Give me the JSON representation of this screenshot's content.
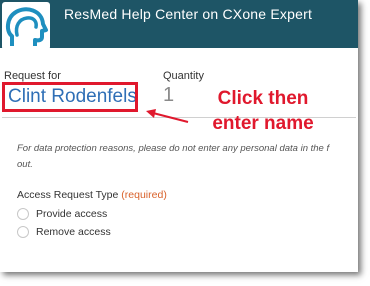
{
  "header": {
    "title": "ResMed Help Center on CXone Expert",
    "logo_icon": "head-silhouette-icon",
    "bg_color": "#1e5566"
  },
  "form": {
    "request_for_label": "Request for",
    "request_for_value": "Clint Rodenfels",
    "quantity_label": "Quantity",
    "quantity_value": "1",
    "notice_line1": "For data protection reasons, please do not enter any personal data in the f",
    "notice_line2": "out.",
    "access_request_label": "Access Request Type",
    "required_text": "(required)",
    "options": [
      {
        "label": "Provide access"
      },
      {
        "label": "Remove access"
      }
    ]
  },
  "annotation": {
    "line1": "Click then",
    "line2": "enter name",
    "color": "#e0182d"
  }
}
